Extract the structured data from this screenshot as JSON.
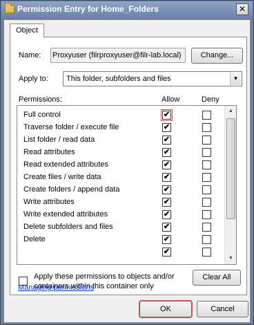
{
  "window": {
    "title": "Permission Entry for Home_Folders",
    "close_glyph": "✕"
  },
  "tabs": [
    {
      "label": "Object"
    }
  ],
  "name": {
    "label": "Name:",
    "value": "Proxyuser (filrproxyuser@filr-lab.local)",
    "change_button": "Change..."
  },
  "apply_to": {
    "label": "Apply to:",
    "value": "This folder, subfolders and files"
  },
  "permissions": {
    "header": "Permissions:",
    "allow_header": "Allow",
    "deny_header": "Deny",
    "items": [
      {
        "label": "Full control",
        "allow": true,
        "deny": false
      },
      {
        "label": "Traverse folder / execute file",
        "allow": true,
        "deny": false
      },
      {
        "label": "List folder / read data",
        "allow": true,
        "deny": false
      },
      {
        "label": "Read attributes",
        "allow": true,
        "deny": false
      },
      {
        "label": "Read extended attributes",
        "allow": true,
        "deny": false
      },
      {
        "label": "Create files / write data",
        "allow": true,
        "deny": false
      },
      {
        "label": "Create folders / append data",
        "allow": true,
        "deny": false
      },
      {
        "label": "Write attributes",
        "allow": true,
        "deny": false
      },
      {
        "label": "Write extended attributes",
        "allow": true,
        "deny": false
      },
      {
        "label": "Delete subfolders and files",
        "allow": true,
        "deny": false
      },
      {
        "label": "Delete",
        "allow": true,
        "deny": false
      },
      {
        "label": "",
        "allow": true,
        "deny": false
      }
    ]
  },
  "apply_container": {
    "label_line1": "Apply these permissions to objects and/or",
    "label_line2": "containers within this container only",
    "checked": false
  },
  "clear_all_button": "Clear All",
  "managing_link": "Managing permissions",
  "footer": {
    "ok": "OK",
    "cancel": "Cancel"
  },
  "check_glyph": "✔",
  "colors": {
    "title_bar": "#6b82ad",
    "dialog_bg": "#f0f0f0",
    "link": "#0033cc",
    "focus_outline": "#d64a4a"
  }
}
